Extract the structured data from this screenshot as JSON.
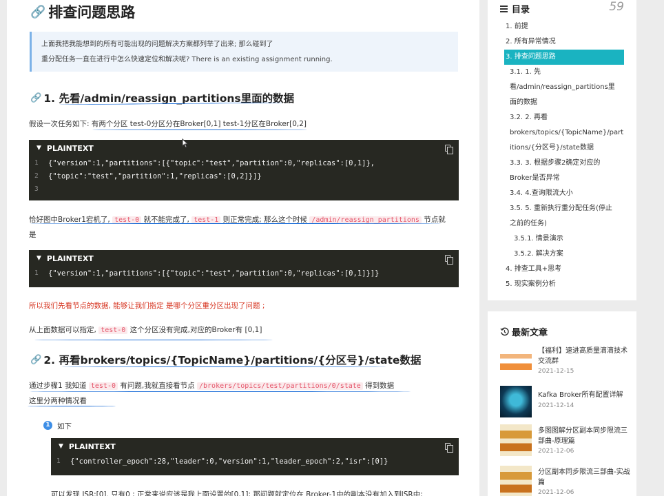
{
  "main": {
    "title": "排查问题思路",
    "note_line1": "上面我把我能想到的所有可能出现的问题解决方案都列举了出来; 那么碰到了",
    "note_line2": "重分配任务一直在进行中怎么快速定位和解决呢? There is an existing assignment running.",
    "section1": {
      "heading": "1. 先看/admin/reassign_partitions里面的数据",
      "p1_a": "假设一次任务如下: ",
      "p1_b": "有两个分区 test-0分区分在Broker[0,1] test-1分区在Broker[0,2]",
      "code1": {
        "lang": "PLAINTEXT",
        "lines": [
          {
            "num": "1",
            "text": "{\"version\":1,\"partitions\":[{\"topic\":\"test\",\"partition\":0,\"replicas\":[0,1]},"
          },
          {
            "num": "2",
            "text": "{\"topic\":\"test\",\"partition\":1,\"replicas\":[0,2]}]}"
          },
          {
            "num": "3",
            "text": ""
          }
        ]
      },
      "p2_a": "恰好图中Broker1宕机了, ",
      "p2_code1": "test-0",
      "p2_b": " 就不能完成了, ",
      "p2_code2": "test-1",
      "p2_c": " 则正常完成; 那么这个时候 ",
      "p2_code3": "/admin/reassign_partitions",
      "p2_d": " 节点就",
      "p2_e": "是",
      "code2": {
        "lang": "PLAINTEXT",
        "lines": [
          {
            "num": "1",
            "text": "{\"version\":1,\"partitions\":[{\"topic\":\"test\",\"partition\":0,\"replicas\":[0,1]}]}"
          }
        ]
      },
      "p3": "所以我们先看节点的数据, 能够让我们指定 是哪个分区重分区出现了问题 ;",
      "p4_a": "从上面数据可以指定, ",
      "p4_code": "test-0",
      "p4_b": " 这个分区没有完成,对应的Broker有 [0,1]"
    },
    "section2": {
      "heading": "2. 再看brokers/topics/{TopicName}/partitions/{分区号}/state数据",
      "p1_a": "通过步骤1 我知道 ",
      "p1_code1": "test-0",
      "p1_b": " 有问题,我就直接看节点 ",
      "p1_code2": "/brokers/topics/test/partitions/0/state",
      "p1_c": " 得到数据",
      "p2": "这里分两种情况看",
      "step_num": "1",
      "step_text": "如下",
      "code3": {
        "lang": "PLAINTEXT",
        "lines": [
          {
            "num": "1",
            "text": "{\"controller_epoch\":28,\"leader\":0,\"version\":1,\"leader_epoch\":2,\"isr\":[0]}"
          }
        ]
      },
      "p3": "可以发现 ISR:[0]. 只有0 ; 正常来说应该是我上面设置的[0,1]; 那问题就定位在 Broker-1中的副本没有加入到ISR中;"
    }
  },
  "toc": {
    "title": "目录",
    "count": "59",
    "items": [
      "1. 前提",
      "2. 所有异常情况",
      "3. 排查问题思路",
      "3.1. 1. 先",
      "看/admin/reassign_partitions里",
      "面的数据",
      "3.2. 2. 再看",
      "brokers/topics/{TopicName}/part",
      "itions/{分区号}/state数据",
      "3.3. 3. 根据步骤2确定对应的",
      "Broker是否异常",
      "3.4. 4.查询限流大小",
      "3.5. 5. 重新执行重分配任务(停止",
      "之前的任务)",
      "3.5.1. 情景演示",
      "3.5.2. 解决方案",
      "4. 排查工具+思考",
      "5. 现实案例分析"
    ]
  },
  "recent": {
    "title": "最新文章",
    "items": [
      {
        "title": "【福利】速进高质量滴滴技术交流群",
        "date": "2021-12-15"
      },
      {
        "title": "Kafka Broker所有配置详解",
        "date": "2021-12-14"
      },
      {
        "title": "多图图解分区副本同步限流三部曲-原理篇",
        "date": "2021-12-06"
      },
      {
        "title": "分区副本同步限流三部曲-实战篇",
        "date": "2021-12-06"
      }
    ]
  },
  "colors": {
    "accent": "#1ab3c1",
    "code_bg": "#272822",
    "inline_code": "#e5566b",
    "highlight_red": "#d6321e",
    "pen_blue": "#1e6fd8"
  }
}
